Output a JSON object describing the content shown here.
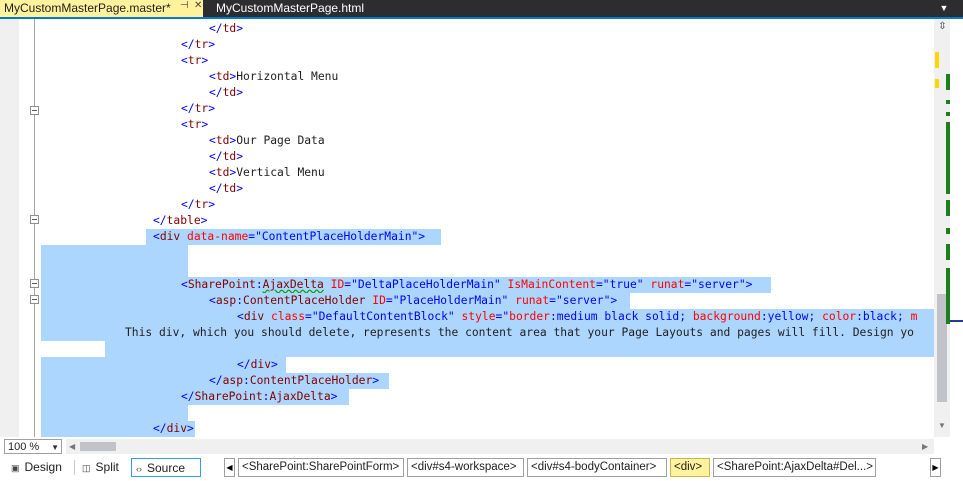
{
  "colors": {
    "selection": "#add6ff",
    "tag_bracket": "#0000ff",
    "tag_name": "#800000",
    "attr_name": "#ff0000",
    "attr_value": "#0000ff",
    "active_tab": "#fff29d",
    "accent": "#007acc"
  },
  "tabs": [
    {
      "label": "MyCustomMasterPage.master*",
      "active": true
    },
    {
      "label": "MyCustomMasterPage.html",
      "active": false
    }
  ],
  "tab_icons": {
    "pin": "pin-icon",
    "close": "close-icon",
    "dropdown": "chevron-down-icon"
  },
  "code_lines": [
    {
      "id": "l0",
      "tokens": [
        [
          "txt",
          "            "
        ],
        [
          "br",
          "</"
        ],
        [
          "tag",
          "td"
        ],
        [
          "br",
          ">"
        ]
      ]
    },
    {
      "id": "l1",
      "tokens": [
        [
          "br",
          "</"
        ],
        [
          "tag",
          "tr"
        ],
        [
          "br",
          ">"
        ]
      ]
    },
    {
      "id": "l2",
      "tokens": [
        [
          "br",
          "<"
        ],
        [
          "tag",
          "tr"
        ],
        [
          "br",
          ">"
        ]
      ]
    },
    {
      "id": "l3",
      "tokens": [
        [
          "br",
          "<"
        ],
        [
          "tag",
          "td"
        ],
        [
          "br",
          ">"
        ],
        [
          "txt",
          "Horizontal Menu"
        ]
      ]
    },
    {
      "id": "l4",
      "tokens": [
        [
          "br",
          "</"
        ],
        [
          "tag",
          "td"
        ],
        [
          "br",
          ">"
        ]
      ]
    },
    {
      "id": "l5",
      "tokens": [
        [
          "br",
          "</"
        ],
        [
          "tag",
          "tr"
        ],
        [
          "br",
          ">"
        ]
      ]
    },
    {
      "id": "l6",
      "tokens": [
        [
          "br",
          "<"
        ],
        [
          "tag",
          "tr"
        ],
        [
          "br",
          ">"
        ]
      ]
    },
    {
      "id": "l7",
      "tokens": [
        [
          "br",
          "<"
        ],
        [
          "tag",
          "td"
        ],
        [
          "br",
          ">"
        ],
        [
          "txt",
          "Our Page Data"
        ]
      ]
    },
    {
      "id": "l8",
      "tokens": [
        [
          "br",
          "</"
        ],
        [
          "tag",
          "td"
        ],
        [
          "br",
          ">"
        ]
      ]
    },
    {
      "id": "l9",
      "tokens": [
        [
          "br",
          "<"
        ],
        [
          "tag",
          "td"
        ],
        [
          "br",
          ">"
        ],
        [
          "txt",
          "Vertical Menu"
        ]
      ]
    },
    {
      "id": "l10",
      "tokens": [
        [
          "br",
          "</"
        ],
        [
          "tag",
          "td"
        ],
        [
          "br",
          ">"
        ]
      ]
    },
    {
      "id": "l11",
      "tokens": [
        [
          "br",
          "</"
        ],
        [
          "tag",
          "tr"
        ],
        [
          "br",
          ">"
        ]
      ]
    },
    {
      "id": "l12",
      "tokens": [
        [
          "br",
          "</"
        ],
        [
          "tag",
          "table"
        ],
        [
          "br",
          ">"
        ]
      ]
    },
    {
      "id": "l13",
      "tokens": [
        [
          "br",
          "<"
        ],
        [
          "tag",
          "div"
        ],
        [
          "txt",
          " "
        ],
        [
          "attr",
          "data-name"
        ],
        [
          "br",
          "="
        ],
        [
          "val",
          "\"ContentPlaceHolderMain\""
        ],
        [
          "br",
          ">"
        ]
      ]
    },
    {
      "id": "l14",
      "tokens": []
    },
    {
      "id": "l15",
      "tokens": []
    },
    {
      "id": "l16",
      "tokens": [
        [
          "br",
          "<"
        ],
        [
          "tag",
          "SharePoint"
        ],
        [
          "br",
          ":"
        ],
        [
          "tag",
          "AjaxDelta"
        ],
        [
          "txt",
          " "
        ],
        [
          "attr",
          "ID"
        ],
        [
          "br",
          "="
        ],
        [
          "val",
          "\"DeltaPlaceHolderMain\""
        ],
        [
          "txt",
          " "
        ],
        [
          "attr",
          "IsMainContent"
        ],
        [
          "br",
          "="
        ],
        [
          "val",
          "\"true\""
        ],
        [
          "txt",
          " "
        ],
        [
          "attr",
          "runat"
        ],
        [
          "br",
          "="
        ],
        [
          "val",
          "\"server\""
        ],
        [
          "br",
          ">"
        ]
      ]
    },
    {
      "id": "l17",
      "tokens": [
        [
          "br",
          "<"
        ],
        [
          "tag",
          "asp"
        ],
        [
          "br",
          ":"
        ],
        [
          "tag",
          "ContentPlaceHolder"
        ],
        [
          "txt",
          " "
        ],
        [
          "attr",
          "ID"
        ],
        [
          "br",
          "="
        ],
        [
          "val",
          "\"PlaceHolderMain\""
        ],
        [
          "txt",
          " "
        ],
        [
          "attr",
          "runat"
        ],
        [
          "br",
          "="
        ],
        [
          "val",
          "\"server\""
        ],
        [
          "br",
          ">"
        ]
      ]
    },
    {
      "id": "l18",
      "tokens": [
        [
          "br",
          "<"
        ],
        [
          "tag",
          "div"
        ],
        [
          "txt",
          " "
        ],
        [
          "attr",
          "class"
        ],
        [
          "br",
          "="
        ],
        [
          "val",
          "\"DefaultContentBlock\""
        ],
        [
          "txt",
          " "
        ],
        [
          "attr",
          "style"
        ],
        [
          "br",
          "="
        ],
        [
          "val",
          "\""
        ],
        [
          "attr",
          "border"
        ],
        [
          "br",
          ":"
        ],
        [
          "val",
          "medium black solid"
        ],
        [
          "br",
          ";"
        ],
        [
          "txt",
          " "
        ],
        [
          "attr",
          "background"
        ],
        [
          "br",
          ":"
        ],
        [
          "val",
          "yellow"
        ],
        [
          "br",
          ";"
        ],
        [
          "txt",
          " "
        ],
        [
          "attr",
          "color"
        ],
        [
          "br",
          ":"
        ],
        [
          "val",
          "black"
        ],
        [
          "br",
          ";"
        ],
        [
          "txt",
          " "
        ],
        [
          "attr",
          "m"
        ]
      ]
    },
    {
      "id": "l19",
      "tokens": [
        [
          "txt",
          "This div, which you should delete, represents the content area that your Page Layouts and pages will fill. Design yo"
        ]
      ]
    },
    {
      "id": "l20",
      "tokens": []
    },
    {
      "id": "l21",
      "tokens": [
        [
          "br",
          "</"
        ],
        [
          "tag",
          "div"
        ],
        [
          "br",
          ">"
        ]
      ]
    },
    {
      "id": "l22",
      "tokens": [
        [
          "br",
          "</"
        ],
        [
          "tag",
          "asp"
        ],
        [
          "br",
          ":"
        ],
        [
          "tag",
          "ContentPlaceHolder"
        ],
        [
          "br",
          ">"
        ]
      ]
    },
    {
      "id": "l23",
      "tokens": [
        [
          "br",
          "</"
        ],
        [
          "tag",
          "SharePoint"
        ],
        [
          "br",
          ":"
        ],
        [
          "tag",
          "AjaxDelta"
        ],
        [
          "br",
          ">"
        ]
      ]
    },
    {
      "id": "l24",
      "tokens": []
    },
    {
      "id": "l25",
      "tokens": [
        [
          "br",
          "</"
        ],
        [
          "tag",
          "div"
        ],
        [
          "br",
          ">"
        ]
      ]
    }
  ],
  "zoom": {
    "value": "100 %"
  },
  "view_modes": [
    {
      "label": "Design",
      "icon": "design-view-icon",
      "active": false
    },
    {
      "label": "Split",
      "icon": "split-view-icon",
      "active": false
    },
    {
      "label": "Source",
      "icon": "source-view-icon",
      "active": true
    }
  ],
  "breadcrumbs": [
    {
      "label": "<SharePoint:SharePointForm>",
      "selected": false
    },
    {
      "label": "<div#s4-workspace>",
      "selected": false
    },
    {
      "label": "<div#s4-bodyContainer>",
      "selected": false
    },
    {
      "label": "<div>",
      "selected": true
    },
    {
      "label": "<SharePoint:AjaxDelta#Del...>",
      "selected": false
    }
  ],
  "breadcrumb_nav": {
    "prev": "chevron-left-icon",
    "next": "chevron-right-icon"
  }
}
